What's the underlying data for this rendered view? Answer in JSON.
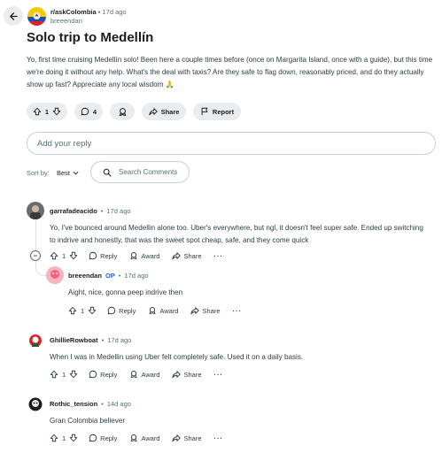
{
  "post": {
    "subreddit": "r/askColombia",
    "dot": "•",
    "age": "17d ago",
    "author": "breeendan",
    "title": "Solo trip to Medellín",
    "body": "Yo, first time cruising Medellín solo! Been here a couple times before (once on Margarita Island, once with a guide), but this time we're doing it without any help. What's the deal with taxis? Are they safe to flag down, reasonably priced, and do they actually show up fast? Appreciate any local wisdom 🙏",
    "votes": "1",
    "comments": "4",
    "share_label": "Share",
    "report_label": "Report"
  },
  "reply_placeholder": "Add your reply",
  "sort": {
    "label": "Sort by:",
    "value": "Best"
  },
  "search": {
    "placeholder": "Search Comments"
  },
  "comments": [
    {
      "author": "garrafadeacido",
      "op": "",
      "dot": "•",
      "age": "17d ago",
      "text": "Yo, I've bounced around Medellin alone too. Uber's everywhere, but ngl, it doesn't feel super safe. Ended up switching to indrive and honestly, that was the sweet spot cheap, safe, and they come quick",
      "votes": "1",
      "reply": "Reply",
      "award": "Award",
      "share": "Share",
      "more": "···"
    },
    {
      "author": "breeendan",
      "op": "OP",
      "dot": "•",
      "age": "17d ago",
      "text": "Aight, nice, gonna peep indrive then",
      "votes": "1",
      "reply": "Reply",
      "award": "Award",
      "share": "Share",
      "more": "···"
    },
    {
      "author": "GhillieRowboat",
      "op": "",
      "dot": "•",
      "age": "17d ago",
      "text": "When I was in Medellin using Uber felt completely safe. Used it on a daily basis.",
      "votes": "1",
      "reply": "Reply",
      "award": "Award",
      "share": "Share",
      "more": "···"
    },
    {
      "author": "Rothic_tension",
      "op": "",
      "dot": "•",
      "age": "14d ago",
      "text": "Gran Colombia believer",
      "votes": "1",
      "reply": "Reply",
      "award": "Award",
      "share": "Share",
      "more": "···"
    }
  ],
  "colors": {
    "accent": "#0a66ff",
    "pill_bg": "#eaedef",
    "muted": "#576f76",
    "flag_yellow": "#f7c900",
    "flag_blue": "#1f4fb3",
    "flag_red": "#d9262e"
  },
  "icons": [
    "back-arrow-icon",
    "upvote-icon",
    "downvote-icon",
    "comment-icon",
    "award-icon",
    "share-icon",
    "report-flag-icon",
    "search-icon",
    "chevron-down-icon",
    "collapse-icon"
  ]
}
